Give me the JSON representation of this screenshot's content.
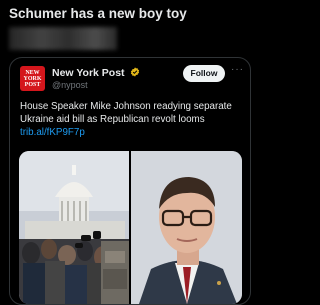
{
  "post": {
    "text": "Schumer has a new boy toy"
  },
  "quoted": {
    "author_name": "New York Post",
    "handle": "@nypost",
    "follow_label": "Follow",
    "more_label": "···",
    "logo_text": [
      "NEW",
      "YORK",
      "POST"
    ],
    "body": "House Speaker Mike Johnson readying separate Ukraine aid bill as Republican revolt looms",
    "link": "trib.al/fKP9F7p"
  },
  "icons": {
    "verified": "verified-badge-icon",
    "more": "more-icon"
  },
  "colors": {
    "background": "#000000",
    "text": "#e7e9ea",
    "muted": "#71767b",
    "link": "#1d9bf0",
    "verified_gold": "#e2b719",
    "logo_red": "#d4161c"
  }
}
